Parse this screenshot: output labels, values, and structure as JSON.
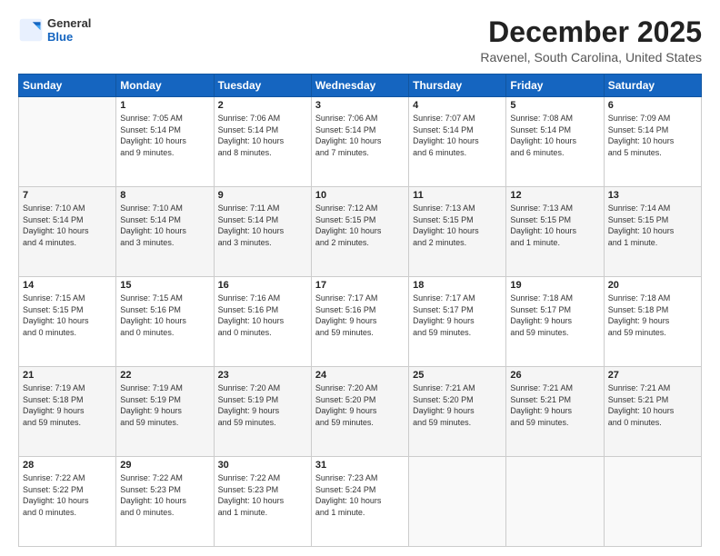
{
  "header": {
    "logo_line1": "General",
    "logo_line2": "Blue",
    "month": "December 2025",
    "location": "Ravenel, South Carolina, United States"
  },
  "weekdays": [
    "Sunday",
    "Monday",
    "Tuesday",
    "Wednesday",
    "Thursday",
    "Friday",
    "Saturday"
  ],
  "weeks": [
    [
      {
        "day": "",
        "info": ""
      },
      {
        "day": "1",
        "info": "Sunrise: 7:05 AM\nSunset: 5:14 PM\nDaylight: 10 hours\nand 9 minutes."
      },
      {
        "day": "2",
        "info": "Sunrise: 7:06 AM\nSunset: 5:14 PM\nDaylight: 10 hours\nand 8 minutes."
      },
      {
        "day": "3",
        "info": "Sunrise: 7:06 AM\nSunset: 5:14 PM\nDaylight: 10 hours\nand 7 minutes."
      },
      {
        "day": "4",
        "info": "Sunrise: 7:07 AM\nSunset: 5:14 PM\nDaylight: 10 hours\nand 6 minutes."
      },
      {
        "day": "5",
        "info": "Sunrise: 7:08 AM\nSunset: 5:14 PM\nDaylight: 10 hours\nand 6 minutes."
      },
      {
        "day": "6",
        "info": "Sunrise: 7:09 AM\nSunset: 5:14 PM\nDaylight: 10 hours\nand 5 minutes."
      }
    ],
    [
      {
        "day": "7",
        "info": "Sunrise: 7:10 AM\nSunset: 5:14 PM\nDaylight: 10 hours\nand 4 minutes."
      },
      {
        "day": "8",
        "info": "Sunrise: 7:10 AM\nSunset: 5:14 PM\nDaylight: 10 hours\nand 3 minutes."
      },
      {
        "day": "9",
        "info": "Sunrise: 7:11 AM\nSunset: 5:14 PM\nDaylight: 10 hours\nand 3 minutes."
      },
      {
        "day": "10",
        "info": "Sunrise: 7:12 AM\nSunset: 5:15 PM\nDaylight: 10 hours\nand 2 minutes."
      },
      {
        "day": "11",
        "info": "Sunrise: 7:13 AM\nSunset: 5:15 PM\nDaylight: 10 hours\nand 2 minutes."
      },
      {
        "day": "12",
        "info": "Sunrise: 7:13 AM\nSunset: 5:15 PM\nDaylight: 10 hours\nand 1 minute."
      },
      {
        "day": "13",
        "info": "Sunrise: 7:14 AM\nSunset: 5:15 PM\nDaylight: 10 hours\nand 1 minute."
      }
    ],
    [
      {
        "day": "14",
        "info": "Sunrise: 7:15 AM\nSunset: 5:15 PM\nDaylight: 10 hours\nand 0 minutes."
      },
      {
        "day": "15",
        "info": "Sunrise: 7:15 AM\nSunset: 5:16 PM\nDaylight: 10 hours\nand 0 minutes."
      },
      {
        "day": "16",
        "info": "Sunrise: 7:16 AM\nSunset: 5:16 PM\nDaylight: 10 hours\nand 0 minutes."
      },
      {
        "day": "17",
        "info": "Sunrise: 7:17 AM\nSunset: 5:16 PM\nDaylight: 9 hours\nand 59 minutes."
      },
      {
        "day": "18",
        "info": "Sunrise: 7:17 AM\nSunset: 5:17 PM\nDaylight: 9 hours\nand 59 minutes."
      },
      {
        "day": "19",
        "info": "Sunrise: 7:18 AM\nSunset: 5:17 PM\nDaylight: 9 hours\nand 59 minutes."
      },
      {
        "day": "20",
        "info": "Sunrise: 7:18 AM\nSunset: 5:18 PM\nDaylight: 9 hours\nand 59 minutes."
      }
    ],
    [
      {
        "day": "21",
        "info": "Sunrise: 7:19 AM\nSunset: 5:18 PM\nDaylight: 9 hours\nand 59 minutes."
      },
      {
        "day": "22",
        "info": "Sunrise: 7:19 AM\nSunset: 5:19 PM\nDaylight: 9 hours\nand 59 minutes."
      },
      {
        "day": "23",
        "info": "Sunrise: 7:20 AM\nSunset: 5:19 PM\nDaylight: 9 hours\nand 59 minutes."
      },
      {
        "day": "24",
        "info": "Sunrise: 7:20 AM\nSunset: 5:20 PM\nDaylight: 9 hours\nand 59 minutes."
      },
      {
        "day": "25",
        "info": "Sunrise: 7:21 AM\nSunset: 5:20 PM\nDaylight: 9 hours\nand 59 minutes."
      },
      {
        "day": "26",
        "info": "Sunrise: 7:21 AM\nSunset: 5:21 PM\nDaylight: 9 hours\nand 59 minutes."
      },
      {
        "day": "27",
        "info": "Sunrise: 7:21 AM\nSunset: 5:21 PM\nDaylight: 10 hours\nand 0 minutes."
      }
    ],
    [
      {
        "day": "28",
        "info": "Sunrise: 7:22 AM\nSunset: 5:22 PM\nDaylight: 10 hours\nand 0 minutes."
      },
      {
        "day": "29",
        "info": "Sunrise: 7:22 AM\nSunset: 5:23 PM\nDaylight: 10 hours\nand 0 minutes."
      },
      {
        "day": "30",
        "info": "Sunrise: 7:22 AM\nSunset: 5:23 PM\nDaylight: 10 hours\nand 1 minute."
      },
      {
        "day": "31",
        "info": "Sunrise: 7:23 AM\nSunset: 5:24 PM\nDaylight: 10 hours\nand 1 minute."
      },
      {
        "day": "",
        "info": ""
      },
      {
        "day": "",
        "info": ""
      },
      {
        "day": "",
        "info": ""
      }
    ]
  ]
}
